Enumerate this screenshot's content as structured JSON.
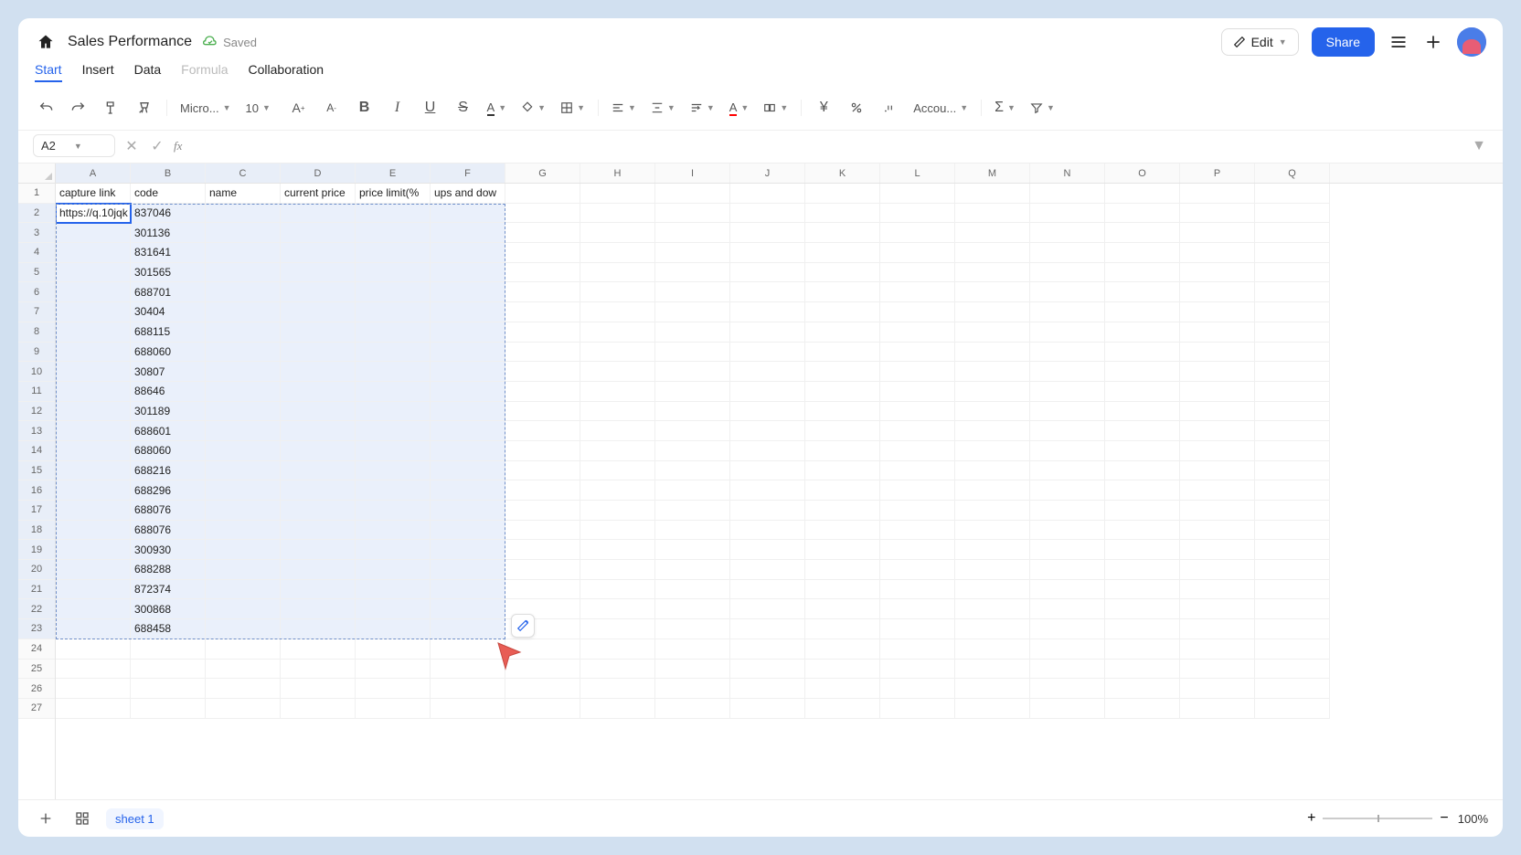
{
  "header": {
    "title": "Sales Performance",
    "saved_label": "Saved",
    "edit_label": "Edit",
    "share_label": "Share"
  },
  "menu": {
    "tabs": [
      "Start",
      "Insert",
      "Data",
      "Formula",
      "Collaboration"
    ],
    "active_index": 0,
    "disabled_index": 3
  },
  "toolbar": {
    "font_name": "Micro...",
    "font_size": "10",
    "number_format": "Accou..."
  },
  "formula_bar": {
    "cell_ref": "A2",
    "fx_label": "fx",
    "value": ""
  },
  "sheet": {
    "columns": [
      "A",
      "B",
      "C",
      "D",
      "E",
      "F",
      "G",
      "H",
      "I",
      "J",
      "K",
      "L",
      "M",
      "N",
      "O",
      "P",
      "Q"
    ],
    "row_count": 27,
    "selected_cols": [
      0,
      1,
      2,
      3,
      4,
      5
    ],
    "selected_rows_start": 2,
    "selected_rows_end": 23,
    "active_cell": "A2",
    "headers_row": [
      "capture link",
      "code",
      "name",
      "current price",
      "price limit(%",
      "ups and dow"
    ],
    "rows": [
      {
        "r": 2,
        "A": "https://q.10jqk",
        "B": "837046"
      },
      {
        "r": 3,
        "B": "301136"
      },
      {
        "r": 4,
        "B": "831641"
      },
      {
        "r": 5,
        "B": "301565"
      },
      {
        "r": 6,
        "B": "688701"
      },
      {
        "r": 7,
        "B": "30404"
      },
      {
        "r": 8,
        "B": "688115"
      },
      {
        "r": 9,
        "B": "688060"
      },
      {
        "r": 10,
        "B": "30807"
      },
      {
        "r": 11,
        "B": "88646"
      },
      {
        "r": 12,
        "B": "301189"
      },
      {
        "r": 13,
        "B": "688601"
      },
      {
        "r": 14,
        "B": "688060"
      },
      {
        "r": 15,
        "B": "688216"
      },
      {
        "r": 16,
        "B": "688296"
      },
      {
        "r": 17,
        "B": "688076"
      },
      {
        "r": 18,
        "B": "688076"
      },
      {
        "r": 19,
        "B": "300930"
      },
      {
        "r": 20,
        "B": "688288"
      },
      {
        "r": 21,
        "B": "872374"
      },
      {
        "r": 22,
        "B": "300868"
      },
      {
        "r": 23,
        "B": "688458"
      }
    ]
  },
  "footer": {
    "sheet_name": "sheet 1",
    "zoom": "100%"
  }
}
